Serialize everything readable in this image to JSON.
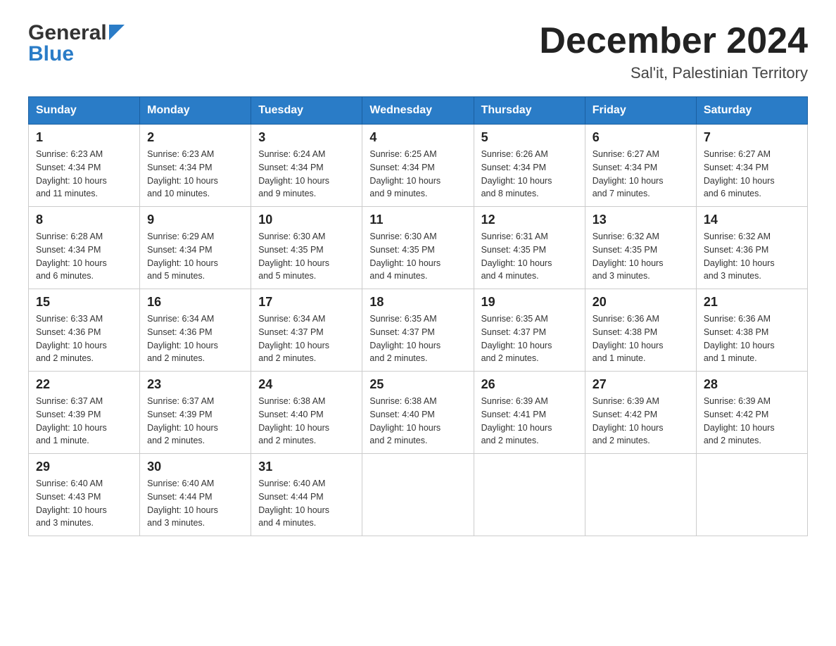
{
  "header": {
    "logo": {
      "text_general": "General",
      "text_blue": "Blue"
    },
    "title": "December 2024",
    "location": "Sal'it, Palestinian Territory"
  },
  "calendar": {
    "days_of_week": [
      "Sunday",
      "Monday",
      "Tuesday",
      "Wednesday",
      "Thursday",
      "Friday",
      "Saturday"
    ],
    "weeks": [
      [
        {
          "day": "1",
          "sunrise": "6:23 AM",
          "sunset": "4:34 PM",
          "daylight": "10 hours and 11 minutes."
        },
        {
          "day": "2",
          "sunrise": "6:23 AM",
          "sunset": "4:34 PM",
          "daylight": "10 hours and 10 minutes."
        },
        {
          "day": "3",
          "sunrise": "6:24 AM",
          "sunset": "4:34 PM",
          "daylight": "10 hours and 9 minutes."
        },
        {
          "day": "4",
          "sunrise": "6:25 AM",
          "sunset": "4:34 PM",
          "daylight": "10 hours and 9 minutes."
        },
        {
          "day": "5",
          "sunrise": "6:26 AM",
          "sunset": "4:34 PM",
          "daylight": "10 hours and 8 minutes."
        },
        {
          "day": "6",
          "sunrise": "6:27 AM",
          "sunset": "4:34 PM",
          "daylight": "10 hours and 7 minutes."
        },
        {
          "day": "7",
          "sunrise": "6:27 AM",
          "sunset": "4:34 PM",
          "daylight": "10 hours and 6 minutes."
        }
      ],
      [
        {
          "day": "8",
          "sunrise": "6:28 AM",
          "sunset": "4:34 PM",
          "daylight": "10 hours and 6 minutes."
        },
        {
          "day": "9",
          "sunrise": "6:29 AM",
          "sunset": "4:34 PM",
          "daylight": "10 hours and 5 minutes."
        },
        {
          "day": "10",
          "sunrise": "6:30 AM",
          "sunset": "4:35 PM",
          "daylight": "10 hours and 5 minutes."
        },
        {
          "day": "11",
          "sunrise": "6:30 AM",
          "sunset": "4:35 PM",
          "daylight": "10 hours and 4 minutes."
        },
        {
          "day": "12",
          "sunrise": "6:31 AM",
          "sunset": "4:35 PM",
          "daylight": "10 hours and 4 minutes."
        },
        {
          "day": "13",
          "sunrise": "6:32 AM",
          "sunset": "4:35 PM",
          "daylight": "10 hours and 3 minutes."
        },
        {
          "day": "14",
          "sunrise": "6:32 AM",
          "sunset": "4:36 PM",
          "daylight": "10 hours and 3 minutes."
        }
      ],
      [
        {
          "day": "15",
          "sunrise": "6:33 AM",
          "sunset": "4:36 PM",
          "daylight": "10 hours and 2 minutes."
        },
        {
          "day": "16",
          "sunrise": "6:34 AM",
          "sunset": "4:36 PM",
          "daylight": "10 hours and 2 minutes."
        },
        {
          "day": "17",
          "sunrise": "6:34 AM",
          "sunset": "4:37 PM",
          "daylight": "10 hours and 2 minutes."
        },
        {
          "day": "18",
          "sunrise": "6:35 AM",
          "sunset": "4:37 PM",
          "daylight": "10 hours and 2 minutes."
        },
        {
          "day": "19",
          "sunrise": "6:35 AM",
          "sunset": "4:37 PM",
          "daylight": "10 hours and 2 minutes."
        },
        {
          "day": "20",
          "sunrise": "6:36 AM",
          "sunset": "4:38 PM",
          "daylight": "10 hours and 1 minute."
        },
        {
          "day": "21",
          "sunrise": "6:36 AM",
          "sunset": "4:38 PM",
          "daylight": "10 hours and 1 minute."
        }
      ],
      [
        {
          "day": "22",
          "sunrise": "6:37 AM",
          "sunset": "4:39 PM",
          "daylight": "10 hours and 1 minute."
        },
        {
          "day": "23",
          "sunrise": "6:37 AM",
          "sunset": "4:39 PM",
          "daylight": "10 hours and 2 minutes."
        },
        {
          "day": "24",
          "sunrise": "6:38 AM",
          "sunset": "4:40 PM",
          "daylight": "10 hours and 2 minutes."
        },
        {
          "day": "25",
          "sunrise": "6:38 AM",
          "sunset": "4:40 PM",
          "daylight": "10 hours and 2 minutes."
        },
        {
          "day": "26",
          "sunrise": "6:39 AM",
          "sunset": "4:41 PM",
          "daylight": "10 hours and 2 minutes."
        },
        {
          "day": "27",
          "sunrise": "6:39 AM",
          "sunset": "4:42 PM",
          "daylight": "10 hours and 2 minutes."
        },
        {
          "day": "28",
          "sunrise": "6:39 AM",
          "sunset": "4:42 PM",
          "daylight": "10 hours and 2 minutes."
        }
      ],
      [
        {
          "day": "29",
          "sunrise": "6:40 AM",
          "sunset": "4:43 PM",
          "daylight": "10 hours and 3 minutes."
        },
        {
          "day": "30",
          "sunrise": "6:40 AM",
          "sunset": "4:44 PM",
          "daylight": "10 hours and 3 minutes."
        },
        {
          "day": "31",
          "sunrise": "6:40 AM",
          "sunset": "4:44 PM",
          "daylight": "10 hours and 4 minutes."
        },
        null,
        null,
        null,
        null
      ]
    ],
    "labels": {
      "sunrise": "Sunrise:",
      "sunset": "Sunset:",
      "daylight": "Daylight:"
    }
  }
}
